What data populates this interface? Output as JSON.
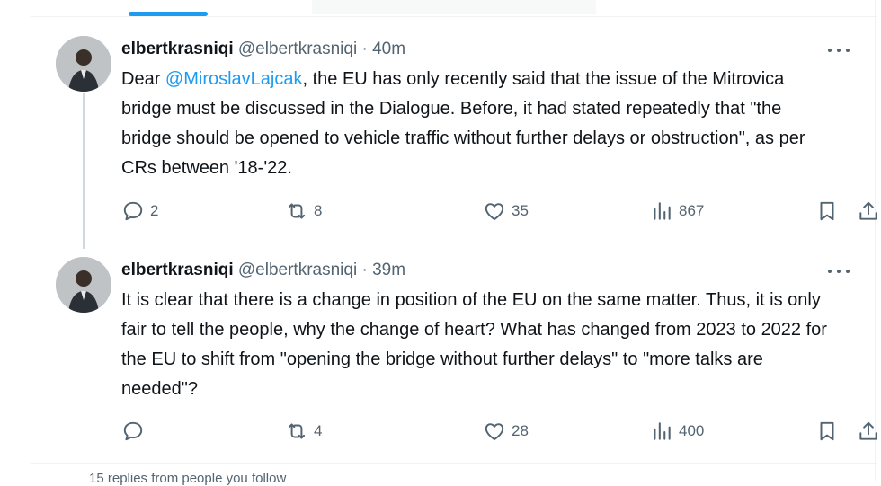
{
  "tweets": [
    {
      "name": "elbertkrasniqi",
      "handle": "@elbertkrasniqi",
      "separator": "·",
      "time": "40m",
      "text_before": "Dear ",
      "mention": "@MiroslavLajcak",
      "text_after": ", the EU has only recently said that the issue of the Mitrovica bridge must be discussed in the Dialogue. Before, it had stated repeatedly that \"the bridge should be opened to vehicle traffic without further delays or obstruction\", as per CRs between '18-'22.",
      "replies": "2",
      "reposts": "8",
      "likes": "35",
      "views": "867"
    },
    {
      "name": "elbertkrasniqi",
      "handle": "@elbertkrasniqi",
      "separator": "·",
      "time": "39m",
      "text": "It is clear that there is a change in position of the EU on the same matter. Thus, it is only fair to tell the people, why the change of heart? What has changed from 2023 to 2022 for the EU to shift from \"opening the bridge without further delays\" to \"more talks are needed\"?",
      "replies": "",
      "reposts": "4",
      "likes": "28",
      "views": "400"
    }
  ],
  "footer": {
    "more_replies": "15 replies from people you follow"
  },
  "colors": {
    "accent": "#1d9bf0",
    "muted": "#536471",
    "text": "#0f1419",
    "divider": "#eff3f4"
  },
  "icons": [
    "reply-icon",
    "repost-icon",
    "like-icon",
    "views-icon",
    "bookmark-icon",
    "share-icon",
    "more-icon"
  ]
}
